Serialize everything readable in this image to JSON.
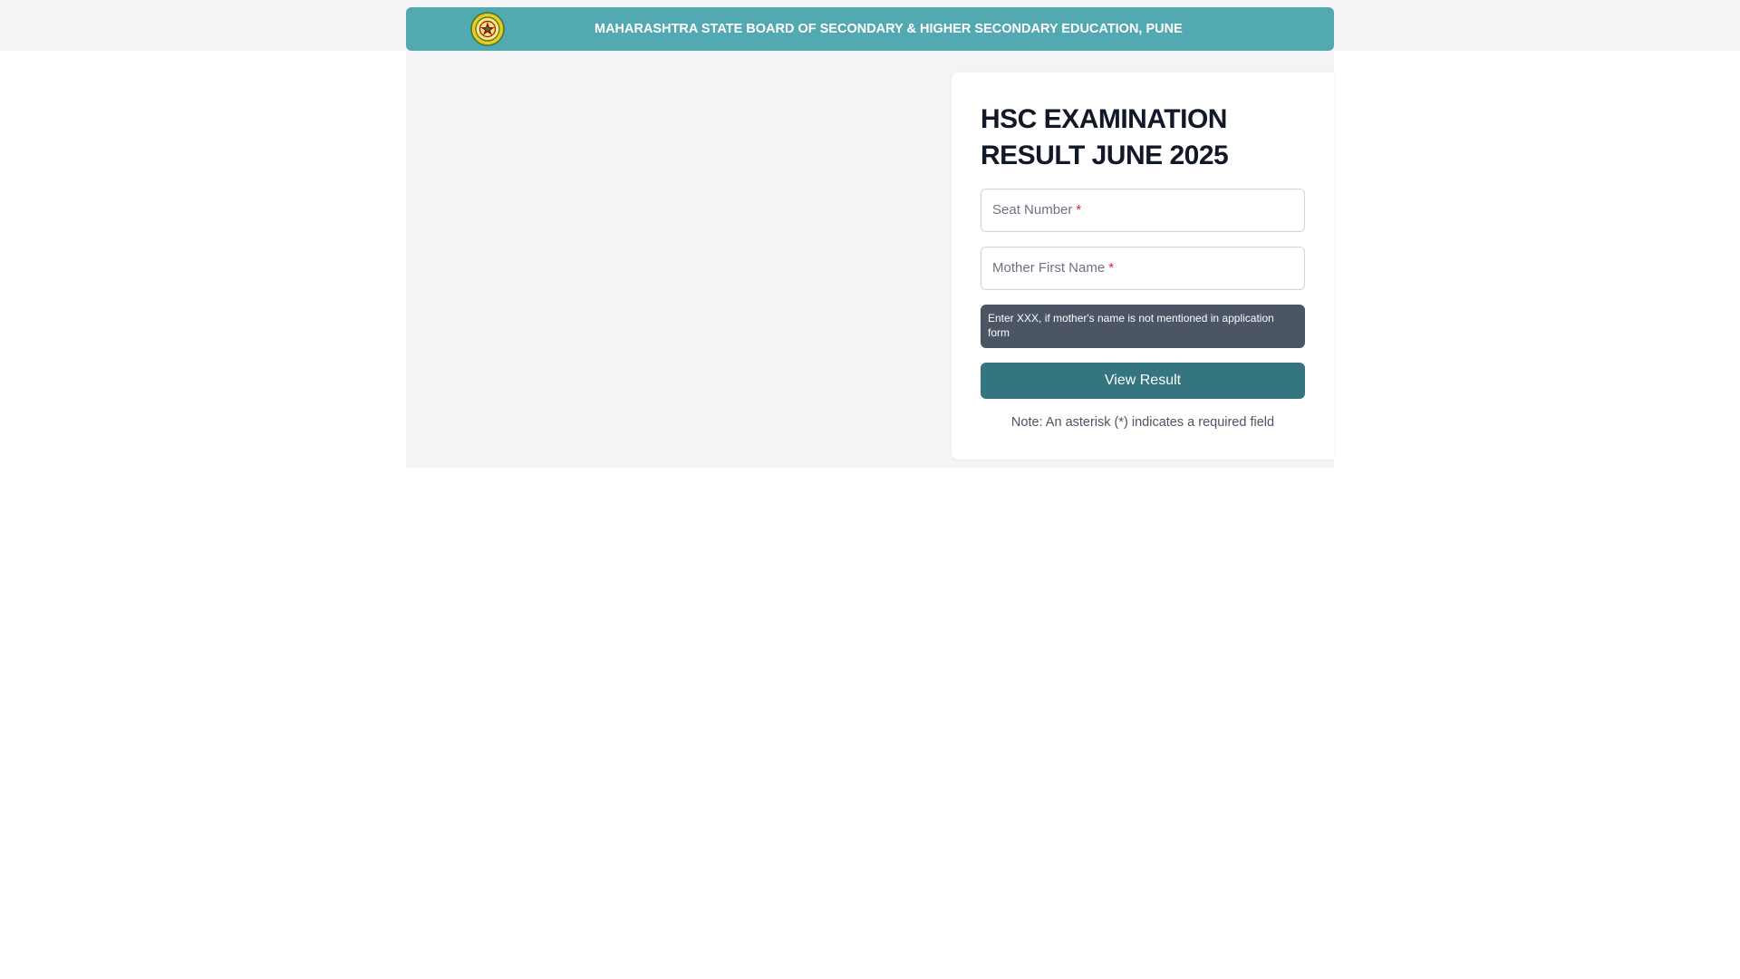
{
  "header": {
    "title": "MAHARASHTRA STATE BOARD OF SECONDARY & HIGHER SECONDARY EDUCATION, PUNE",
    "logo_icon": "board-emblem-icon",
    "background_color": "#53a9b2"
  },
  "card": {
    "title": "HSC EXAMINATION RESULT JUNE 2025",
    "fields": {
      "seat_number": {
        "label": "Seat Number",
        "required_mark": "*",
        "value": ""
      },
      "mother_first_name": {
        "label": "Mother First Name",
        "required_mark": "*",
        "value": ""
      }
    },
    "hint": "Enter XXX, if mother's name is not mentioned in application form",
    "submit_label": "View Result",
    "note": "Note: An asterisk (*) indicates a required field"
  },
  "colors": {
    "accent": "#347580",
    "required": "#dc2626",
    "hint_background": "#4b5563"
  }
}
